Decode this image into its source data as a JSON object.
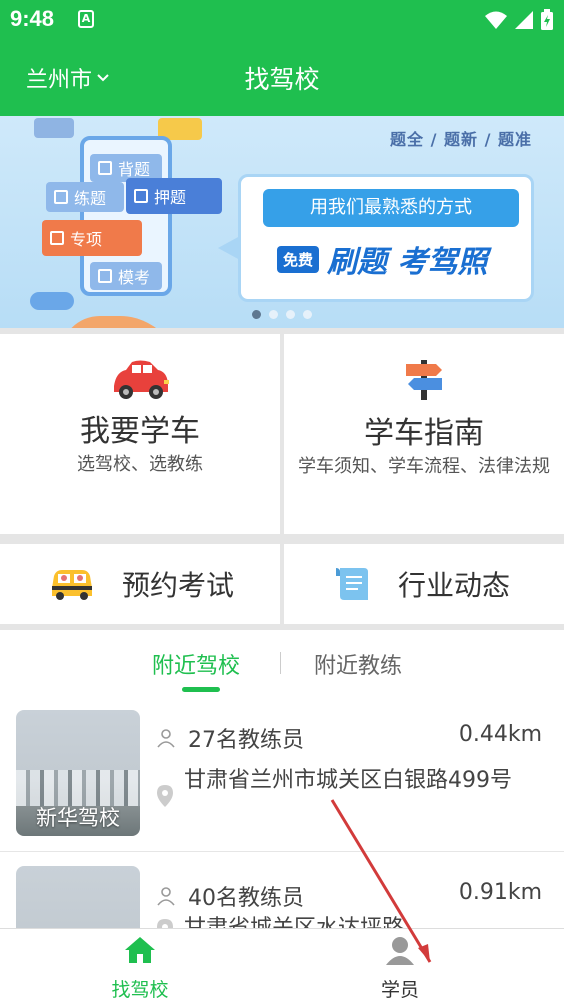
{
  "status_bar": {
    "time": "9:48",
    "sim_glyph": "A"
  },
  "header": {
    "city": "兰州市",
    "title": "找驾校",
    "bg_color": "#1fbf4f"
  },
  "banner": {
    "top_text": "题全 / 题新 / 题准",
    "chips": [
      "背题",
      "押题",
      "练题",
      "专项",
      "模考"
    ],
    "headline": "用我们最熟悉的方式",
    "free_badge": "免费",
    "slogan": "刷题 考驾照",
    "page_count": 4,
    "active_page": 1
  },
  "features": {
    "learn": {
      "title": "我要学车",
      "subtitle": "选驾校、选教练",
      "icon": "car-icon"
    },
    "guide": {
      "title": "学车指南",
      "subtitle": "学车须知、学车流程、法律法规",
      "icon": "signpost-icon"
    },
    "exam": {
      "label": "预约考试",
      "icon": "taxi-icon"
    },
    "news": {
      "label": "行业动态",
      "icon": "document-icon"
    }
  },
  "tabs": {
    "nearby_schools": "附近驾校",
    "nearby_coaches": "附近教练"
  },
  "schools": [
    {
      "name": "新华驾校",
      "coaches": "27名教练员",
      "distance": "0.44km",
      "address": "甘肃省兰州市城关区白银路499号"
    },
    {
      "name": "",
      "coaches": "40名教练员",
      "distance": "0.91km",
      "address": "甘肃省城关区水达坪路"
    }
  ],
  "bottom_nav": {
    "find_school": "找驾校",
    "student": "学员",
    "active_color": "#1fbf4f"
  }
}
